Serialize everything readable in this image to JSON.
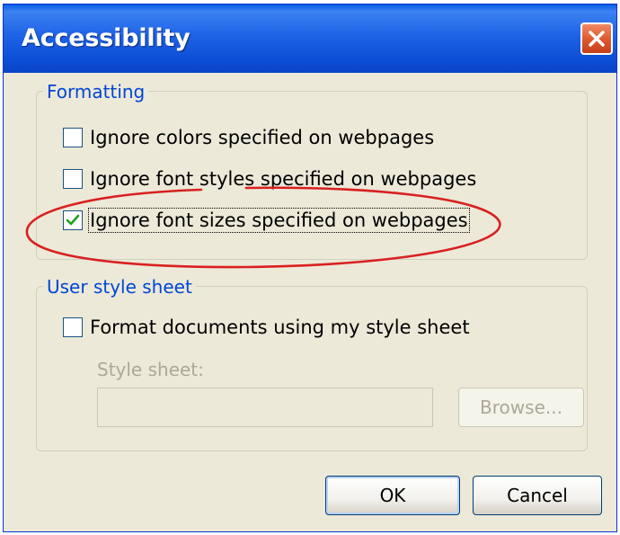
{
  "window": {
    "title": "Accessibility"
  },
  "formatting": {
    "label": "Formatting",
    "options": [
      {
        "label": "Ignore colors specified on webpages",
        "checked": false
      },
      {
        "label": "Ignore font styles specified on webpages",
        "checked": false
      },
      {
        "label": "Ignore font sizes specified on webpages",
        "checked": true
      }
    ]
  },
  "user_style_sheet": {
    "label": "User style sheet",
    "option": {
      "label": "Format documents using my style sheet",
      "checked": false
    },
    "style_sheet_label": "Style sheet:",
    "style_sheet_value": "",
    "browse_label": "Browse..."
  },
  "buttons": {
    "ok": "OK",
    "cancel": "Cancel"
  },
  "colors": {
    "title_bar": "#0a5ce3",
    "dialog_bg": "#ece9d8",
    "group_label": "#0046d5",
    "annotation": "#d92020"
  }
}
